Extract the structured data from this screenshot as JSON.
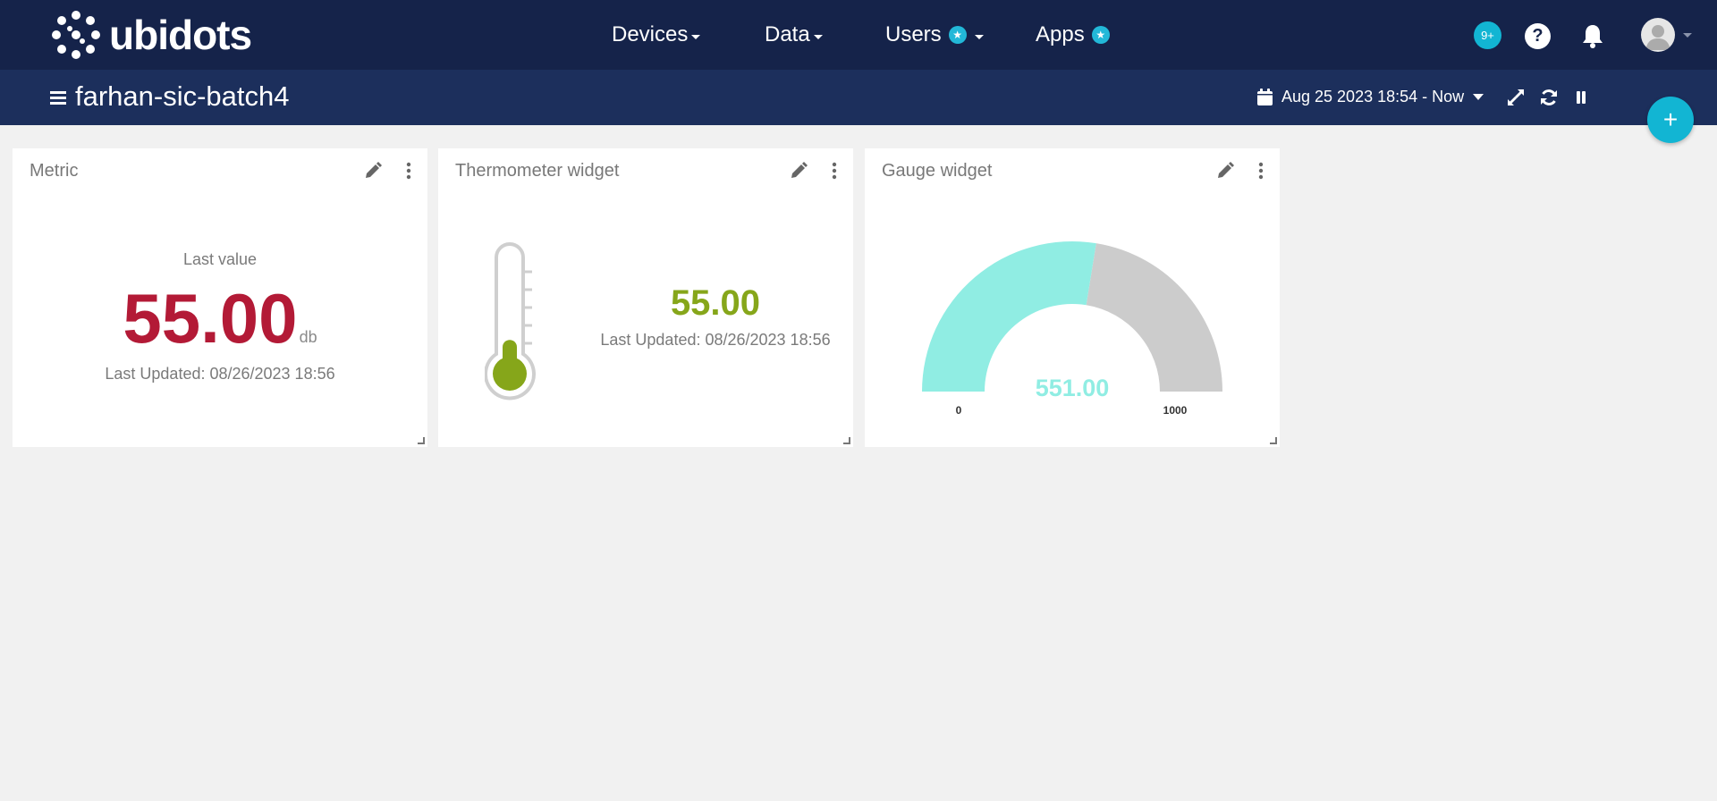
{
  "brand": {
    "name": "ubidots"
  },
  "nav": {
    "items": [
      {
        "label": "Devices",
        "has_star": false
      },
      {
        "label": "Data",
        "has_star": false
      },
      {
        "label": "Users",
        "has_star": true
      },
      {
        "label": "Apps",
        "has_star": true
      }
    ],
    "notifications_badge": "9+",
    "help_icon": "?"
  },
  "dashboard": {
    "title": "farhan-sic-batch4",
    "date_range": "Aug 25 2023 18:54 - Now"
  },
  "fab": {
    "label": "+"
  },
  "widgets": {
    "metric": {
      "title": "Metric",
      "label": "Last value",
      "value": "55.00",
      "unit": "db",
      "updated": "Last Updated: 08/26/2023 18:56",
      "color": "#b31a36"
    },
    "thermometer": {
      "title": "Thermometer widget",
      "value": "55.00",
      "updated": "Last Updated: 08/26/2023 18:56",
      "level": 0.3,
      "color": "#86a61a"
    },
    "gauge": {
      "title": "Gauge widget",
      "value": "551.00",
      "min": "0",
      "max": "1000",
      "fraction": 0.551,
      "color": "#90ede3",
      "rest_color": "#cccccc"
    }
  },
  "colors": {
    "topbar": "#15234a",
    "subbar": "#1c2f5c",
    "accent": "#12b5d3",
    "background": "#f1f1f1"
  }
}
